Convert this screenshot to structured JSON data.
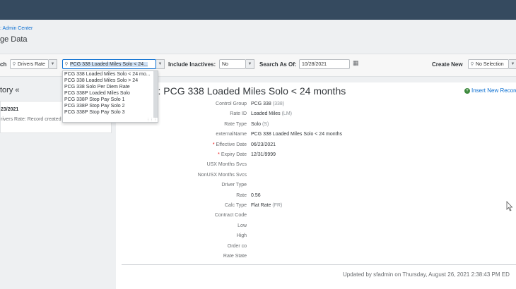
{
  "header": {
    "breadcrumb": ": Admin Center",
    "page_title": "ge Data"
  },
  "filters": {
    "search_label": "ch",
    "search_value": "Drivers Rate",
    "record_value": "PCG 338 Loaded Miles Solo < 24...",
    "inactive_label": "Include Inactives:",
    "inactive_value": "No",
    "asof_label": "Search As Of:",
    "asof_value": "10/28/2021",
    "createnew_label": "Create New",
    "createnew_value": "No Selection"
  },
  "dropdown": {
    "options": [
      "PCG 338 Loaded Miles Solo < 24 mo...",
      "PCG 338 Loaded Miles Solo > 24",
      "PCG 338 Solo Per Diem Rate",
      "PCG 338P Loaded Miles Solo",
      "PCG 338P Stop Pay Solo 1",
      "PCG 338P Stop Pay Solo 2",
      "PCG 338P Stop Pay Solo 3"
    ]
  },
  "history": {
    "title": "tory «",
    "date": "23/2021",
    "note": "rivers Rate: Record created"
  },
  "detail": {
    "title": "ate: PCG 338 Loaded Miles Solo < 24 months",
    "insert_label": "Insert New Record",
    "fields": [
      {
        "label": "Control Group",
        "value": "PCG 338",
        "extra": "(338)",
        "required": false
      },
      {
        "label": "Rate ID",
        "value": "Loaded Miles",
        "extra": "(LM)",
        "required": false
      },
      {
        "label": "Rate Type",
        "value": "Solo",
        "extra": "(S)",
        "required": false
      },
      {
        "label": "externalName",
        "value": "PCG 338 Loaded Miles Solo < 24 months",
        "extra": "",
        "required": false
      },
      {
        "label": "Effective Date",
        "value": "06/23/2021",
        "extra": "",
        "required": true
      },
      {
        "label": "Expiry Date",
        "value": "12/31/9999",
        "extra": "",
        "required": true
      },
      {
        "label": "USX Months Svcs",
        "value": "",
        "extra": "",
        "required": false
      },
      {
        "label": "NonUSX Months Svcs",
        "value": "",
        "extra": "",
        "required": false
      },
      {
        "label": "Driver Type",
        "value": "",
        "extra": "",
        "required": false
      },
      {
        "label": "Rate",
        "value": "0.56",
        "extra": "",
        "required": false
      },
      {
        "label": "Calc Type",
        "value": "Flat Rate",
        "extra": "(FR)",
        "required": false
      },
      {
        "label": "Contract Code",
        "value": "",
        "extra": "",
        "required": false
      },
      {
        "label": "Low",
        "value": "",
        "extra": "",
        "required": false
      },
      {
        "label": "High",
        "value": "",
        "extra": "",
        "required": false
      },
      {
        "label": "Order co",
        "value": "",
        "extra": "",
        "required": false
      },
      {
        "label": "Rate State",
        "value": "",
        "extra": "",
        "required": false
      }
    ],
    "updated": "Updated by sfadmin on Thursday, August 26, 2021 2:38:43 PM ED"
  }
}
